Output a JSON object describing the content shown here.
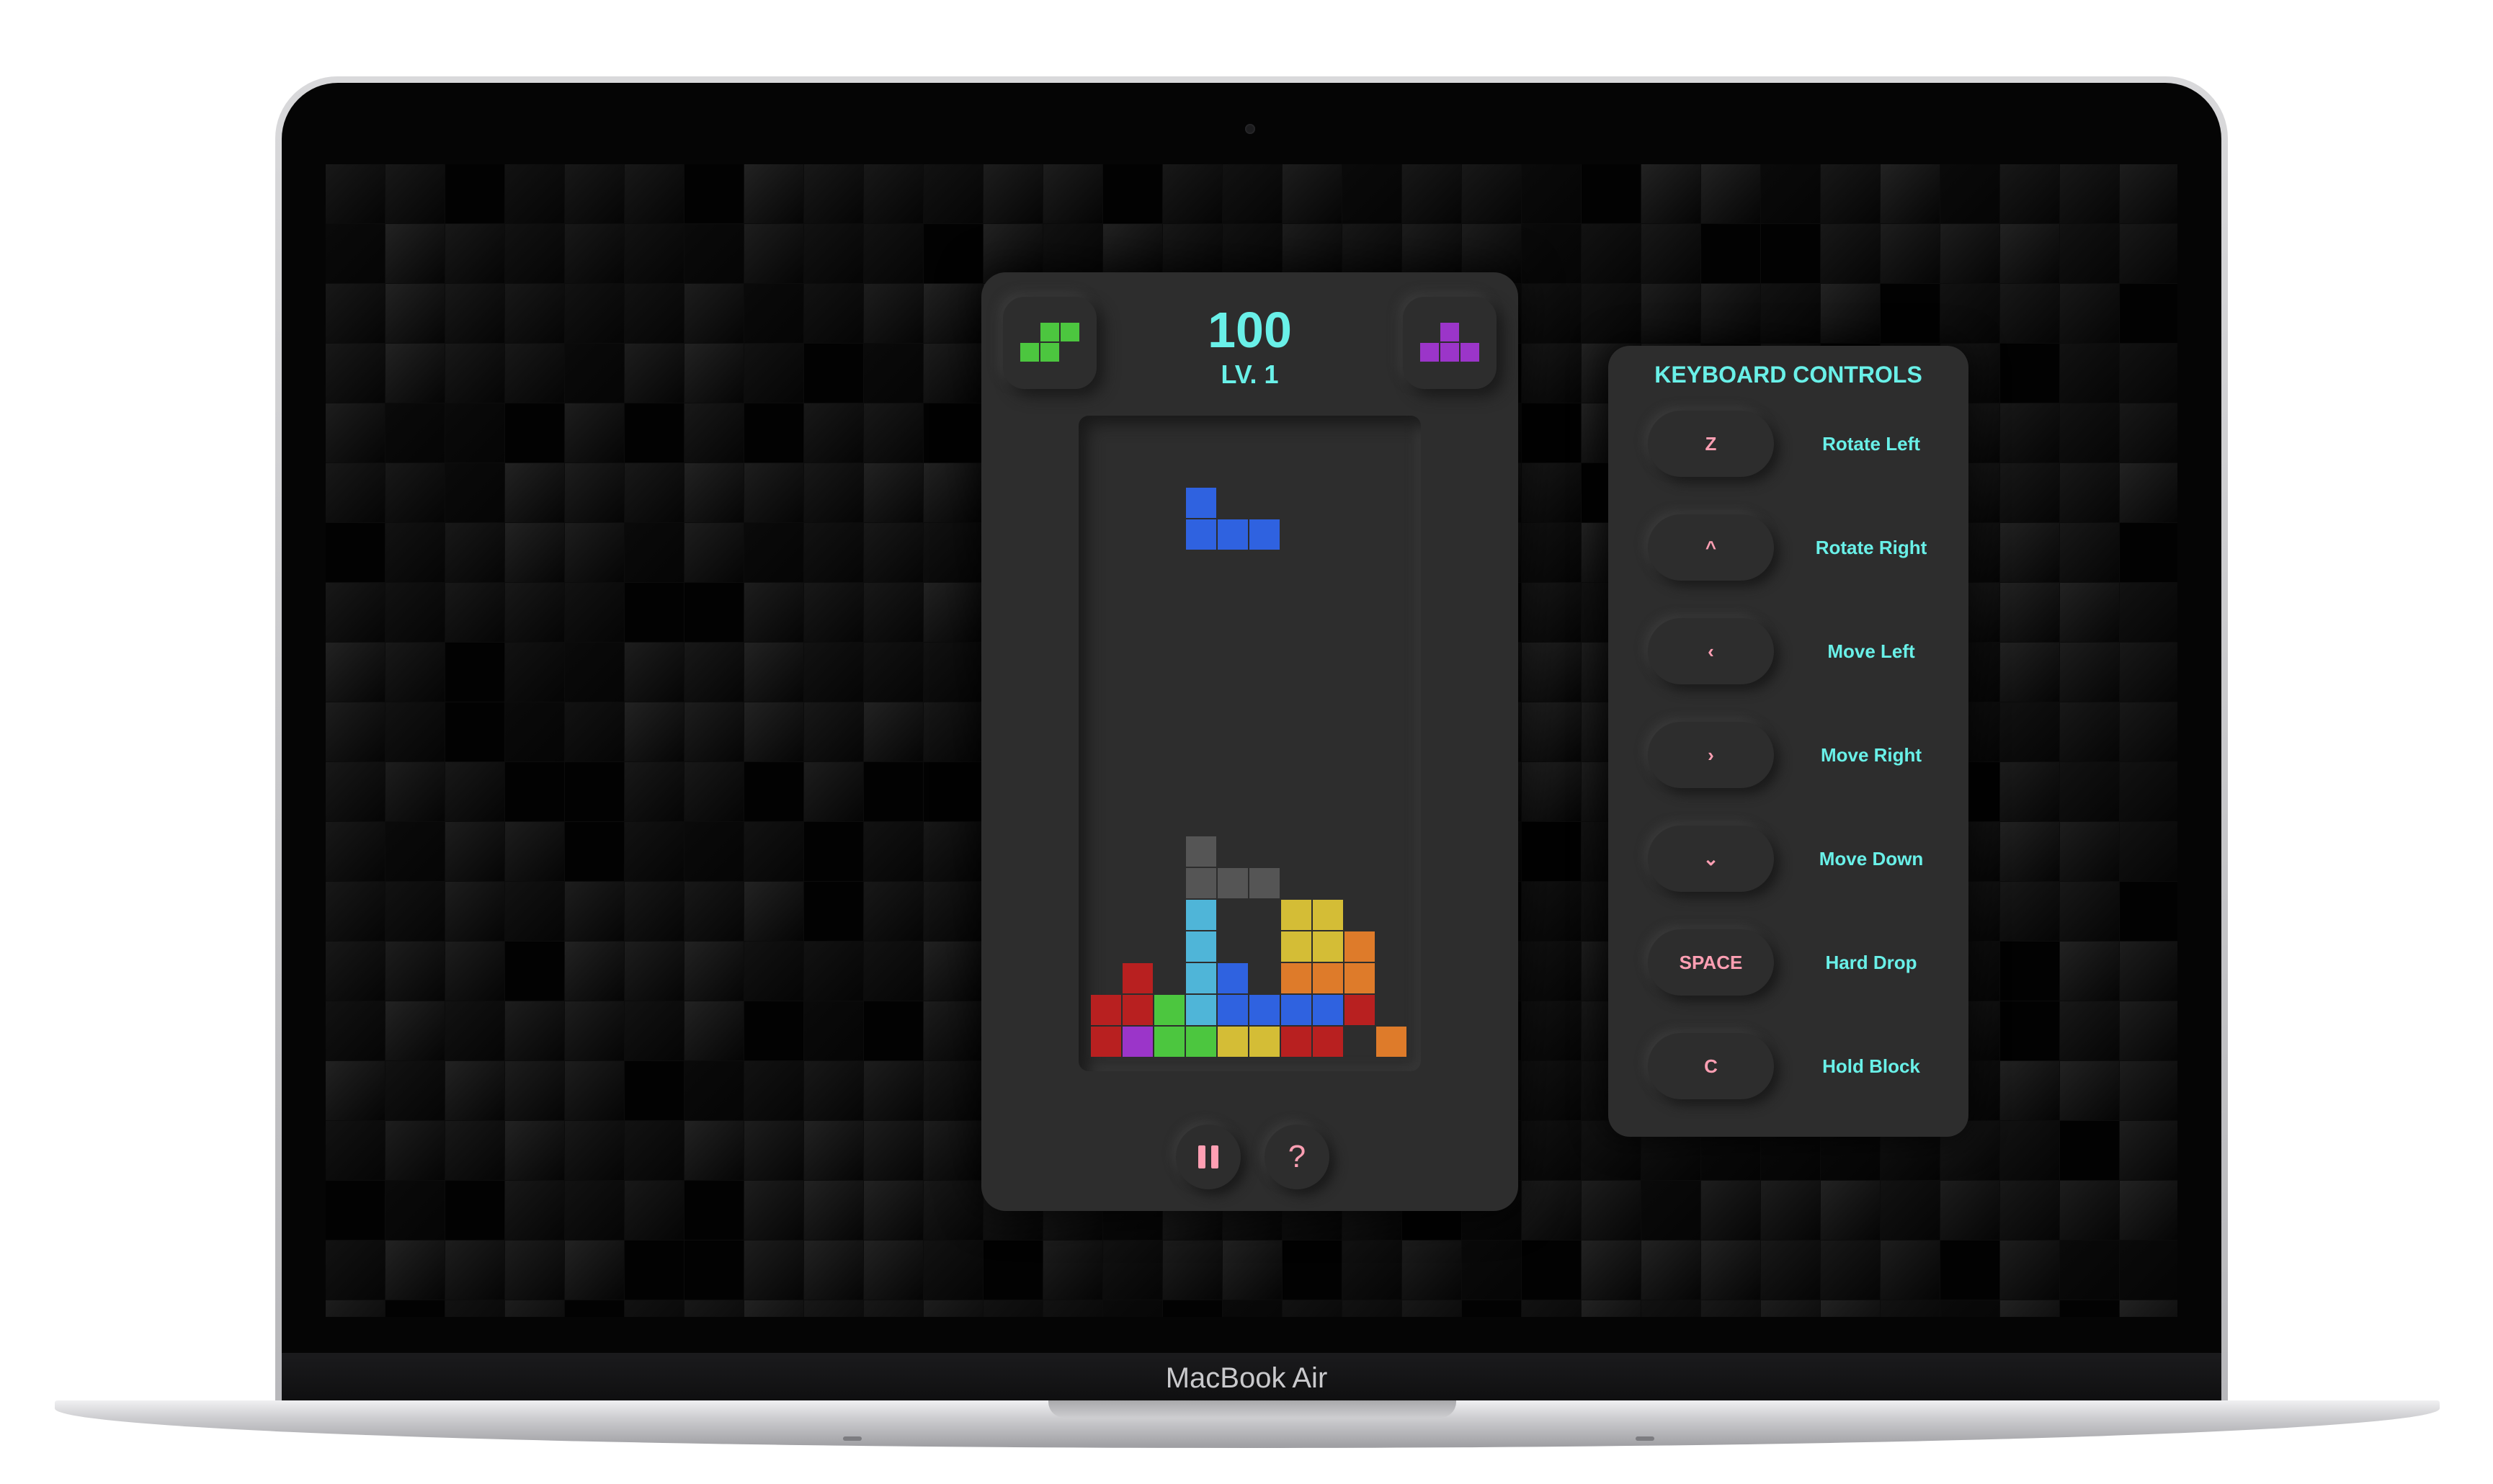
{
  "device": {
    "brand_label": "MacBook Air"
  },
  "game": {
    "score": "100",
    "level": "LV. 1",
    "hold_piece": {
      "shape": "S",
      "color": "#4cc63f",
      "cells": [
        [
          1,
          0
        ],
        [
          2,
          0
        ],
        [
          0,
          1
        ],
        [
          1,
          1
        ]
      ]
    },
    "next_piece": {
      "shape": "T",
      "color": "#9b35c9",
      "cells": [
        [
          1,
          0
        ],
        [
          0,
          1
        ],
        [
          1,
          1
        ],
        [
          2,
          1
        ]
      ]
    },
    "board": {
      "cols": 10,
      "rows": 20,
      "falling_piece": {
        "shape": "J",
        "color": "#2f62e0",
        "cells": [
          [
            3,
            2
          ],
          [
            3,
            3
          ],
          [
            4,
            3
          ],
          [
            5,
            3
          ]
        ]
      },
      "locked_cells": [
        [
          3,
          13,
          "#555555"
        ],
        [
          3,
          14,
          "#555555"
        ],
        [
          4,
          14,
          "#555555"
        ],
        [
          5,
          14,
          "#555555"
        ],
        [
          3,
          15,
          "#4fb5d8"
        ],
        [
          6,
          15,
          "#d4bd36"
        ],
        [
          7,
          15,
          "#d4bd36"
        ],
        [
          3,
          16,
          "#4fb5d8"
        ],
        [
          6,
          16,
          "#d4bd36"
        ],
        [
          7,
          16,
          "#d4bd36"
        ],
        [
          8,
          16,
          "#de7b2a"
        ],
        [
          1,
          17,
          "#b82020"
        ],
        [
          3,
          17,
          "#4fb5d8"
        ],
        [
          4,
          17,
          "#2f62e0"
        ],
        [
          6,
          17,
          "#de7b2a"
        ],
        [
          7,
          17,
          "#de7b2a"
        ],
        [
          8,
          17,
          "#de7b2a"
        ],
        [
          0,
          18,
          "#b82020"
        ],
        [
          1,
          18,
          "#b82020"
        ],
        [
          2,
          18,
          "#4cc63f"
        ],
        [
          3,
          18,
          "#4fb5d8"
        ],
        [
          4,
          18,
          "#2f62e0"
        ],
        [
          5,
          18,
          "#2f62e0"
        ],
        [
          6,
          18,
          "#2f62e0"
        ],
        [
          7,
          18,
          "#2f62e0"
        ],
        [
          8,
          18,
          "#b82020"
        ],
        [
          0,
          19,
          "#b82020"
        ],
        [
          1,
          19,
          "#9b35c9"
        ],
        [
          2,
          19,
          "#4cc63f"
        ],
        [
          3,
          19,
          "#4cc63f"
        ],
        [
          4,
          19,
          "#d4bd36"
        ],
        [
          5,
          19,
          "#d4bd36"
        ],
        [
          6,
          19,
          "#b82020"
        ],
        [
          7,
          19,
          "#b82020"
        ],
        [
          9,
          19,
          "#de7b2a"
        ]
      ]
    },
    "buttons": {
      "pause_icon": "pause-icon",
      "help_label": "?"
    }
  },
  "keyboard_controls": {
    "title": "KEYBOARD CONTROLS",
    "items": [
      {
        "key": "Z",
        "action": "Rotate Left"
      },
      {
        "key": "^",
        "action": "Rotate Right"
      },
      {
        "key": "‹",
        "action": "Move Left"
      },
      {
        "key": "›",
        "action": "Move Right"
      },
      {
        "key": "⌄",
        "action": "Move Down"
      },
      {
        "key": "SPACE",
        "action": "Hard Drop"
      },
      {
        "key": "C",
        "action": "Hold Block"
      }
    ]
  },
  "colors": {
    "accent_cyan": "#69f0e8",
    "accent_pink": "#ff9fb3",
    "panel": "#2d2d2d"
  }
}
